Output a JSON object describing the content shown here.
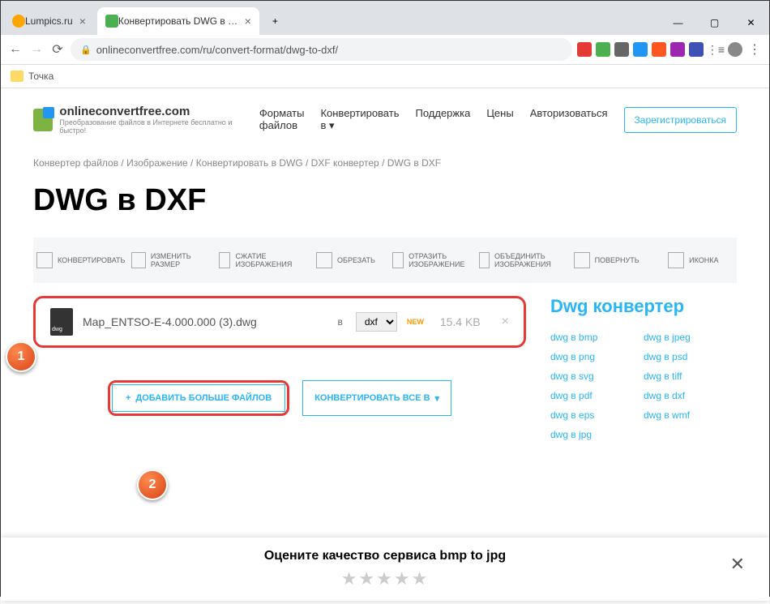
{
  "browser": {
    "tabs": [
      {
        "title": "Lumpics.ru",
        "active": false
      },
      {
        "title": "Конвертировать DWG в DXF он",
        "active": true
      }
    ],
    "url": "onlineconvertfree.com/ru/convert-format/dwg-to-dxf/",
    "new_tab_plus": "+"
  },
  "bookmarks": {
    "item1": "Точка"
  },
  "logo": {
    "text": "onlineconvertfree.com",
    "sub": "Преобразование файлов в Интернете бесплатно и быстро!"
  },
  "nav": {
    "formats": "Форматы файлов",
    "convert": "Конвертировать в",
    "support": "Поддержка",
    "prices": "Цены",
    "login": "Авторизоваться",
    "register": "Зарегистрироваться"
  },
  "breadcrumb": {
    "p1": "Конвертер файлов",
    "p2": "Изображение",
    "p3": "Конвертировать в DWG",
    "p4": "DXF конвертер",
    "p5": "DWG в DXF",
    "sep": " / "
  },
  "heading": "DWG в DXF",
  "tools": {
    "t1": "КОНВЕРТИРОВАТЬ",
    "t2": "ИЗМЕНИТЬ РАЗМЕР",
    "t3": "СЖАТИЕ ИЗОБРАЖЕНИЯ",
    "t4": "ОБРЕЗАТЬ",
    "t5": "ОТРАЗИТЬ ИЗОБРАЖЕНИЕ",
    "t6": "ОБЪЕДИНИТЬ ИЗОБРАЖЕНИЯ",
    "t7": "ПОВЕРНУТЬ",
    "t8": "ИКОНКА"
  },
  "file": {
    "name": "Map_ENTSO-E-4.000.000 (3).dwg",
    "to": "в",
    "format": "dxf",
    "new": "NEW",
    "size": "15.4 KB"
  },
  "buttons": {
    "add_more": "ДОБАВИТЬ БОЛЬШЕ ФАЙЛОВ",
    "convert_all": "КОНВЕРТИРОВАТЬ ВСЕ В"
  },
  "markers": {
    "m1": "1",
    "m2": "2"
  },
  "side": {
    "title": "Dwg конвертер",
    "links": [
      "dwg в bmp",
      "dwg в jpeg",
      "dwg в png",
      "dwg в psd",
      "dwg в svg",
      "dwg в tiff",
      "dwg в pdf",
      "dwg в dxf",
      "dwg в eps",
      "dwg в wmf",
      "dwg в jpg"
    ]
  },
  "rating": {
    "title": "Оцените качество сервиса bmp to jpg",
    "stars": "★★★★★"
  }
}
